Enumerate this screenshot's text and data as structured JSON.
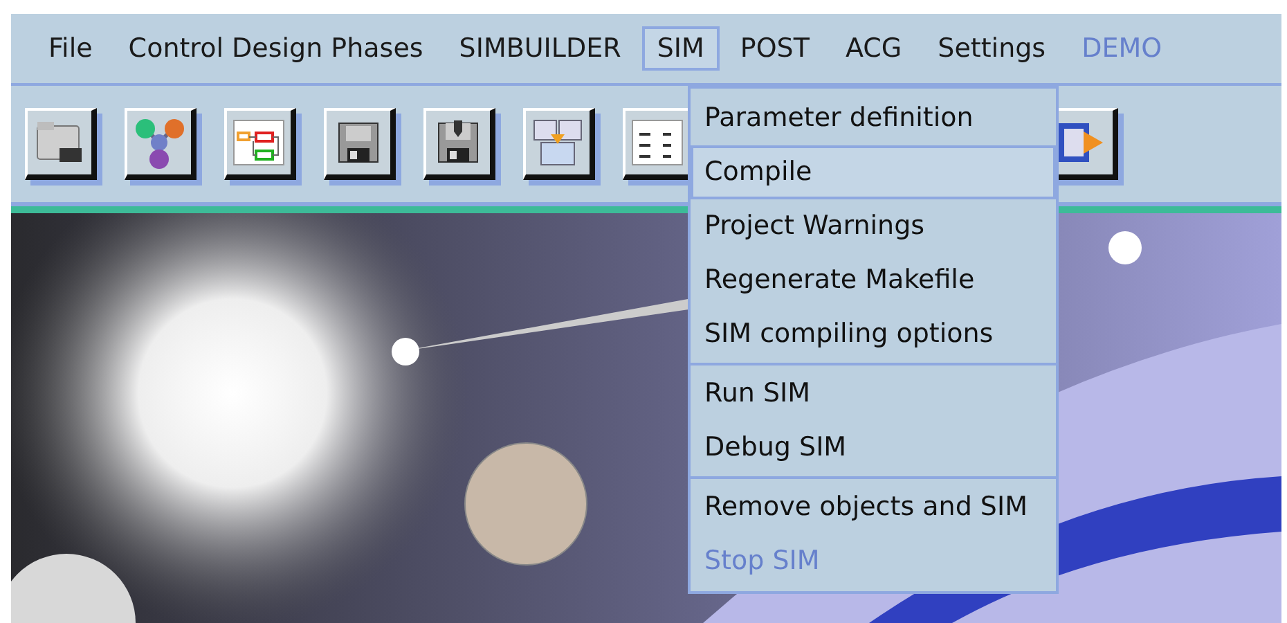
{
  "menu_bar": [
    {
      "label": "File",
      "selected": false,
      "disabled": false
    },
    {
      "label": "Control Design Phases",
      "selected": false,
      "disabled": false
    },
    {
      "label": "SIMBUILDER",
      "selected": false,
      "disabled": false
    },
    {
      "label": "SIM",
      "selected": true,
      "disabled": false
    },
    {
      "label": "POST",
      "selected": false,
      "disabled": false
    },
    {
      "label": "ACG",
      "selected": false,
      "disabled": false
    },
    {
      "label": "Settings",
      "selected": false,
      "disabled": false
    },
    {
      "label": "DEMO",
      "selected": false,
      "disabled": true
    }
  ],
  "toolbar": [
    {
      "kind": "folder"
    },
    {
      "kind": "molecule"
    },
    {
      "kind": "diagram"
    },
    {
      "kind": "save"
    },
    {
      "kind": "save-as"
    },
    {
      "kind": "layout"
    },
    {
      "kind": "blocks"
    },
    {
      "kind": "export"
    }
  ],
  "sim_menu": [
    {
      "kind": "item",
      "label": "Parameter definition",
      "selected": false,
      "disabled": false
    },
    {
      "kind": "item",
      "label": "Compile",
      "selected": true,
      "disabled": false
    },
    {
      "kind": "item",
      "label": "Project Warnings",
      "selected": false,
      "disabled": false
    },
    {
      "kind": "item",
      "label": "Regenerate Makefile",
      "selected": false,
      "disabled": false
    },
    {
      "kind": "item",
      "label": "SIM compiling options",
      "selected": false,
      "disabled": false
    },
    {
      "kind": "separator"
    },
    {
      "kind": "item",
      "label": "Run SIM",
      "selected": false,
      "disabled": false
    },
    {
      "kind": "item",
      "label": "Debug SIM",
      "selected": false,
      "disabled": false
    },
    {
      "kind": "separator"
    },
    {
      "kind": "item",
      "label": "Remove objects and SIM",
      "selected": false,
      "disabled": false
    },
    {
      "kind": "item",
      "label": "Stop SIM",
      "selected": false,
      "disabled": true
    }
  ]
}
